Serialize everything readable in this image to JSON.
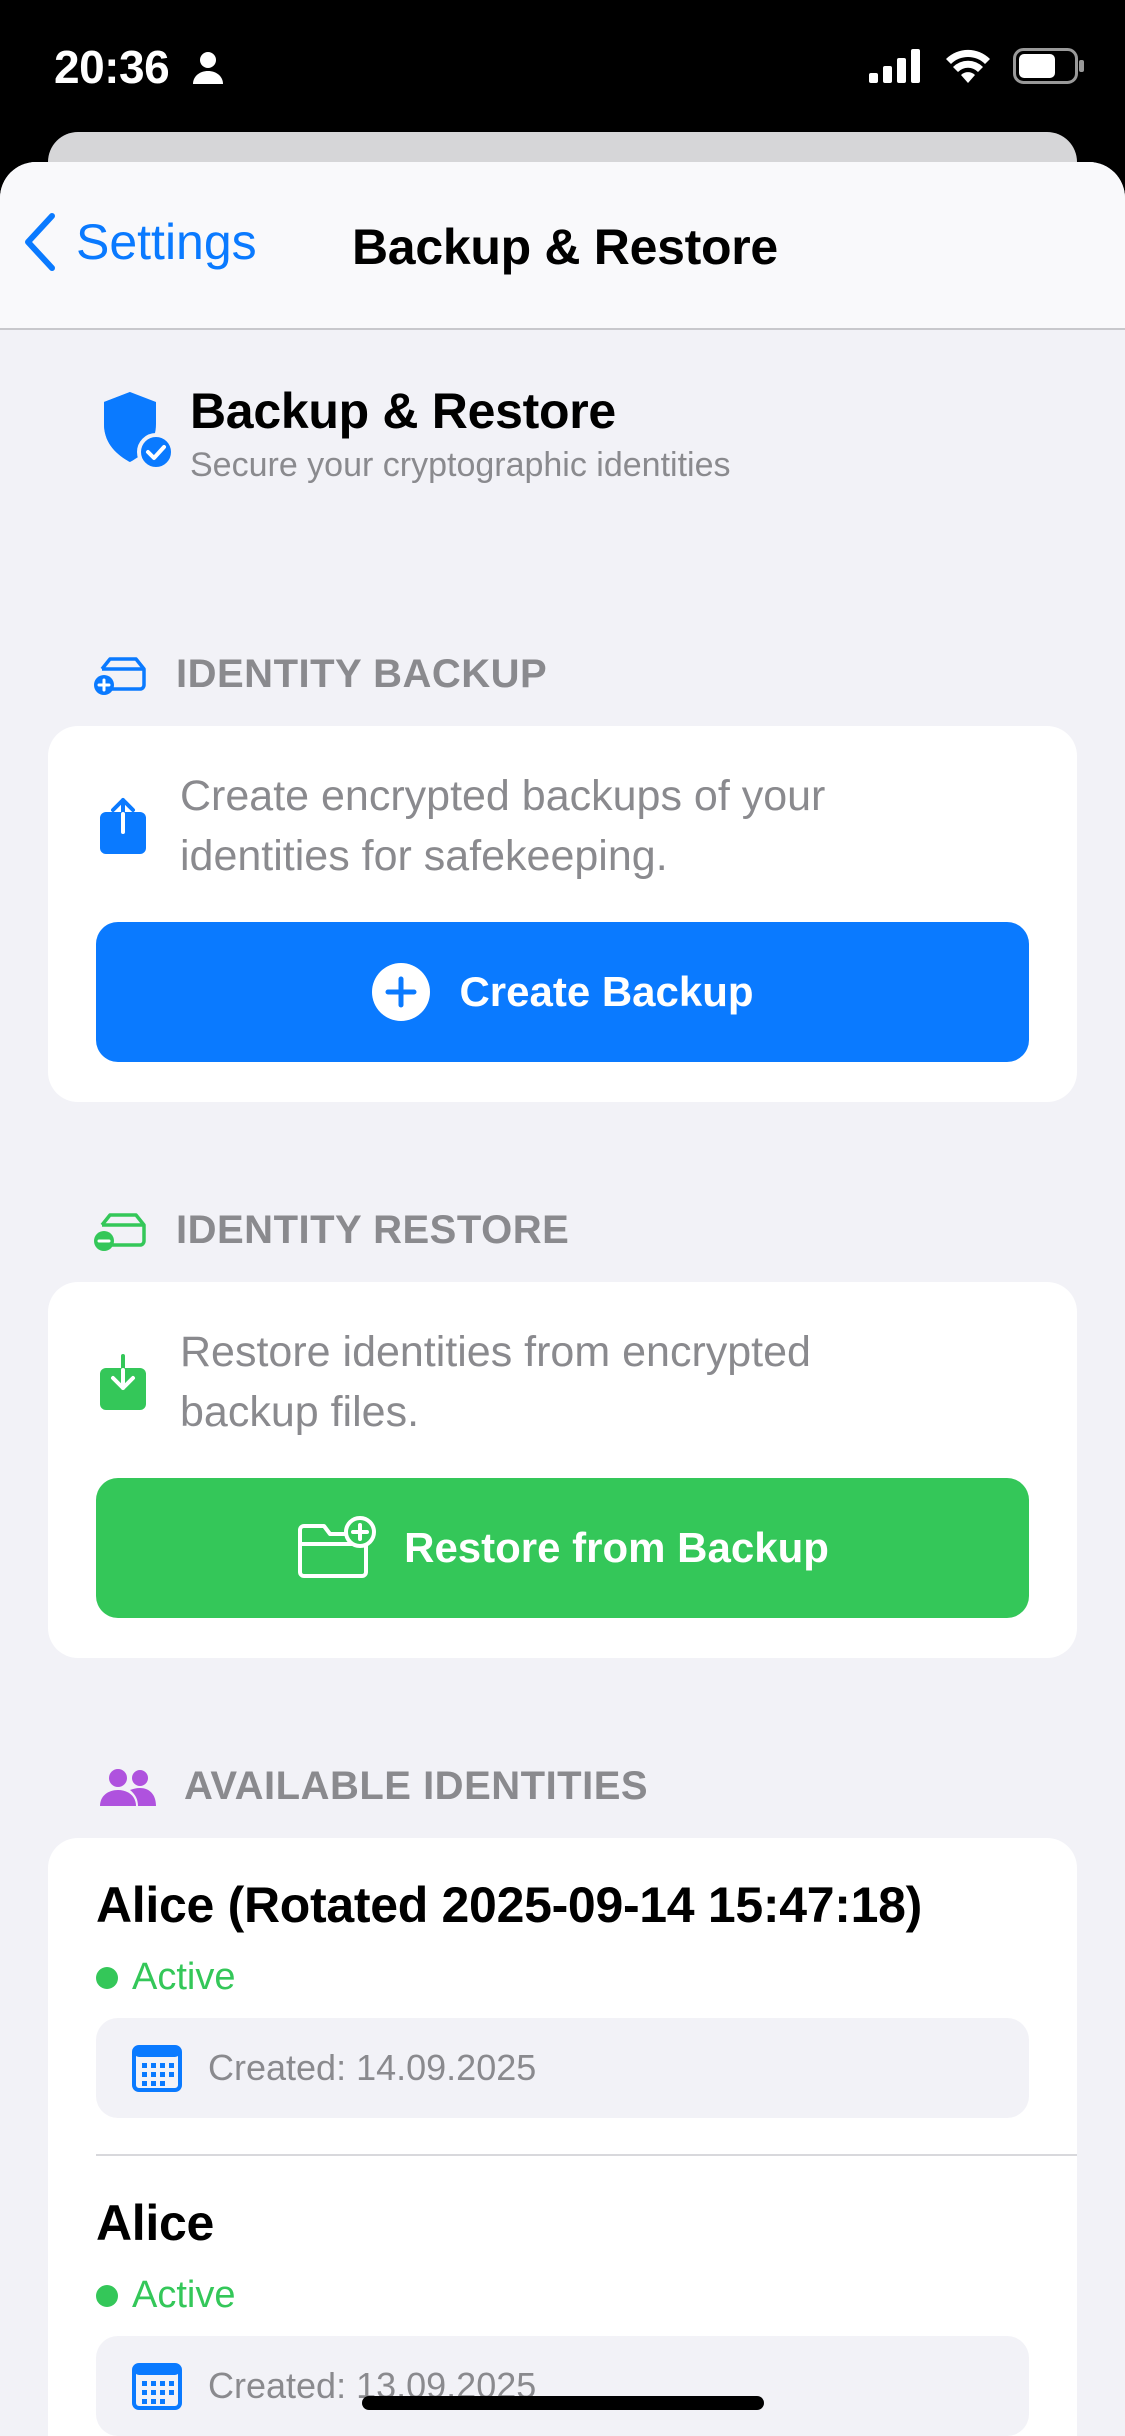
{
  "status_bar": {
    "time": "20:36"
  },
  "nav": {
    "back_label": "Settings",
    "title": "Backup & Restore"
  },
  "header": {
    "title": "Backup & Restore",
    "subtitle": "Secure your cryptographic identities"
  },
  "backup": {
    "section_label": "IDENTITY BACKUP",
    "description": "Create encrypted backups of your identities for safekeeping.",
    "button_label": "Create Backup"
  },
  "restore": {
    "section_label": "IDENTITY RESTORE",
    "description": "Restore identities from encrypted backup files.",
    "button_label": "Restore from Backup"
  },
  "identities": {
    "section_label": "AVAILABLE IDENTITIES",
    "items": [
      {
        "name": "Alice (Rotated 2025-09-14 15:47:18)",
        "status": "Active",
        "created": "Created: 14.09.2025"
      },
      {
        "name": "Alice",
        "status": "Active",
        "created": "Created: 13.09.2025"
      }
    ]
  },
  "colors": {
    "accent_blue": "#0a7aff",
    "accent_green": "#34c759",
    "accent_purple": "#af52de",
    "background": "#f2f2f7"
  }
}
